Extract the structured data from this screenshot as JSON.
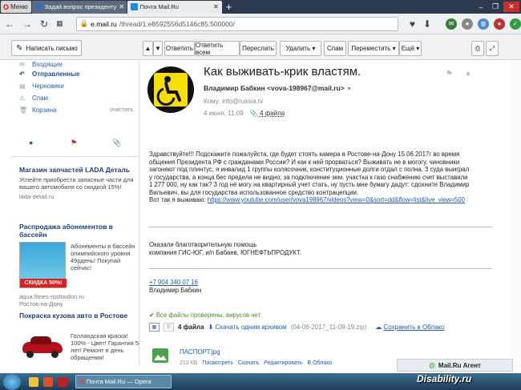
{
  "browser": {
    "menu_label": "Меню",
    "tabs": [
      {
        "title": "Задай вопрос президенту",
        "active": false
      },
      {
        "title": "Почта Mail.Ru",
        "active": true
      }
    ],
    "url_domain": "e.mail.ru",
    "url_path": "/thread/1:e8592556d5146c85:500000/"
  },
  "toolbar": {
    "compose_label": "Написать письмо",
    "buttons": [
      "Ответить",
      "Ответить всем",
      "Переслать",
      "Удалить",
      "Спам",
      "Переместить",
      "Ещё"
    ]
  },
  "sidebar": {
    "folders": [
      {
        "label": "Входящие",
        "selected": false,
        "action": ""
      },
      {
        "label": "Отправленные",
        "selected": true,
        "action": ""
      },
      {
        "label": "Черновики",
        "selected": false,
        "action": ""
      },
      {
        "label": "Спам",
        "selected": false,
        "action": ""
      },
      {
        "label": "Корзина",
        "selected": false,
        "action": "очистить"
      }
    ],
    "ads": [
      {
        "title": "Магазин запчастей LADA Деталь",
        "text": "Успейте приобрести запасные части для вашего автомобиля со скидкой 15%!",
        "url": "lada-detail.ru"
      },
      {
        "title": "Распродажа абонементов в бассейн",
        "text": "Абонементы в бассейн олимпийского уровня 49рдень! Покупай сейчас!",
        "badge": "СКИДКА 50%!",
        "url": "aqua.fitnes-rostovdon.ru",
        "location": "Ростов-на-Дону"
      },
      {
        "title": "Покраска кузова авто в Ростове",
        "text": "Голландская краска! 100% - Цвет! Гарантия 5 лет! Ремонт в день обращения!",
        "url": ""
      }
    ]
  },
  "message": {
    "subject": "Как выживать-крик властям.",
    "sender_name": "Владимир Бабкин",
    "sender_email": "<vova-198967@mail.ru>",
    "to_label": "Кому:",
    "to_value": "info@russia.tv",
    "date": "4 июня, 11:09",
    "files_link": "4 файла",
    "body_lines": [
      "Здравствуйте!!! Подскажите пожалуйста, где будет стоять камера в Ростове-на-Дону 15.06.2017г во время",
      "общения Президента РФ с гражданами России? И как к ней прорваться? Выживать не в могогу, чиновники",
      "загоняют под плинтус, я инвалид 1 группы колясочник, конституционные долги отдал с полна, 3 суда выиграл",
      "у государства, а конца бес предела не видно, за подключение зем. участка к газо снабжению счет выставили",
      "1 277 000, ну как так? 3 год не могу на квартирный учет стать, ну пусть мне бумагу дадут: сдохните Владимир",
      "Вильевич, вы для государства использованное средство контрацепции."
    ],
    "body_last_prefix": "Вот так я выживаю: ",
    "body_link": "https://www.youtube.com/user/vova198967/videos?view=0&sort=dd&flow=list&live_view=500",
    "sig_lines": [
      "Оказали благотворительную помощь",
      "компания ГИС-ЮГ, и/п Бабаев, ЮГНЕФТЬПРОДУКТ."
    ],
    "phone": "+7 904 340 07 16",
    "sig_name": "Владимир Бабкин"
  },
  "attachments": {
    "virus_check": "Все файлы проверены, вирусов нет",
    "count_label": "4 файла",
    "download_all": "Скачать одним архивом",
    "archive_name": "(04-06-2017_11-09-19.zip)",
    "save_cloud": "Сохранить в Облако",
    "files": [
      {
        "name": "ПАСПОРТ.jpg",
        "size": "213 КБ",
        "actions": [
          "Посмотреть",
          "Скачать",
          "Редактировать",
          "В Облако"
        ]
      }
    ]
  },
  "agent_label": "Mail.Ru Агент",
  "taskbar": {
    "task_title": "Почта Mail.Ru — Opera"
  },
  "watermark": "Disability.ru",
  "colors": {
    "accent": "#2159b8",
    "tabbar": "#2b3a4f",
    "avatar_bg": "#111111",
    "avatar_fg": "#f7e000"
  }
}
